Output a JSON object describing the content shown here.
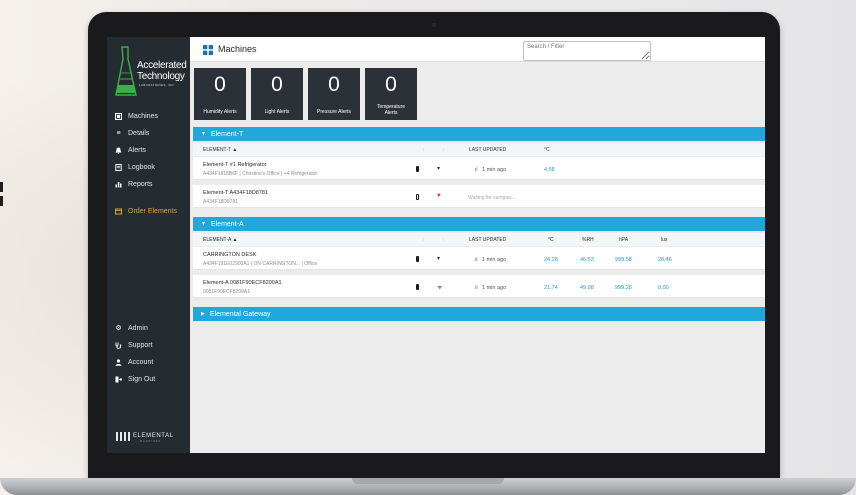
{
  "brand": {
    "line1": "Accelerated",
    "line2": "Technology",
    "line3": "LABORATORIES, INC.",
    "partner": "ELEMENTAL",
    "partner_sub": "MACHINES"
  },
  "colors": {
    "sidebar": "#242b31",
    "accent": "#21a7d9",
    "order_link": "#e0a33a",
    "alert_card": "#2b3137",
    "value_blue": "#1e9bd0",
    "alert_red": "#d62d2d"
  },
  "nav": {
    "machines": "Machines",
    "details": "Details",
    "alerts": "Alerts",
    "logbook": "Logbook",
    "reports": "Reports",
    "order": "Order Elements",
    "admin": "Admin",
    "support": "Support",
    "account": "Account",
    "signout": "Sign Out"
  },
  "icons": {
    "machines": "square-icon",
    "details": "list-icon",
    "alerts": "bell-icon",
    "logbook": "book-icon",
    "reports": "bar-chart-icon",
    "order": "credit-card-icon",
    "admin": "gear-icon",
    "support": "stethoscope-icon",
    "account": "user-icon",
    "signout": "sign-out-icon",
    "page": "grid-icon"
  },
  "header": {
    "title": "Machines",
    "search_placeholder": "Search / Filter"
  },
  "alerts": {
    "humidity": {
      "count": "0",
      "label": "Humidity Alerts"
    },
    "light": {
      "count": "0",
      "label": "Light Alerts"
    },
    "pressure": {
      "count": "0",
      "label": "Pressure Alerts"
    },
    "temperature": {
      "count": "0",
      "label1": "Temperature",
      "label2": "Alerts"
    }
  },
  "sections": {
    "t": {
      "title": "Element-T",
      "columns": {
        "name": "ELEMENT-T",
        "updated": "LAST UPDATED",
        "c": "°C"
      },
      "rows": [
        {
          "name": "Element-T #1 Refrigerator",
          "sub": "A434F1918B6F  |  Christine's Office  |  +4 Refrigerator",
          "updated": "1 min ago",
          "c": "4.58",
          "battery": "full",
          "wifi": "ok"
        },
        {
          "name": "Element-T A434F18D8781",
          "sub": "A434F18D8781",
          "updated": "Waiting for samples...",
          "battery": "low",
          "wifi": "alert"
        }
      ]
    },
    "a": {
      "title": "Element-A",
      "columns": {
        "name": "ELEMENT-A",
        "updated": "LAST UPDATED",
        "c": "°C",
        "rh": "%RH",
        "hpa": "hPA",
        "lux": "lux"
      },
      "rows": [
        {
          "name": "CARRINGTON DESK",
          "sub": "A434F191E02900A1  |  ON CARRINGTON...  |  Office",
          "updated": "1 min ago",
          "c": "24.28",
          "rh": "46.53",
          "hpa": "999.58",
          "lux": "28.46",
          "battery": "full",
          "wifi": "ok"
        },
        {
          "name": "Element-A 0081F90ECF8200A1",
          "sub": "0081F90ECF8200A1",
          "updated": "1 min ago",
          "c": "21.74",
          "rh": "49.98",
          "hpa": "999.28",
          "lux": "0.00",
          "battery": "full",
          "wifi": "ok"
        }
      ]
    },
    "gateway": {
      "title": "Elemental Gateway"
    }
  }
}
